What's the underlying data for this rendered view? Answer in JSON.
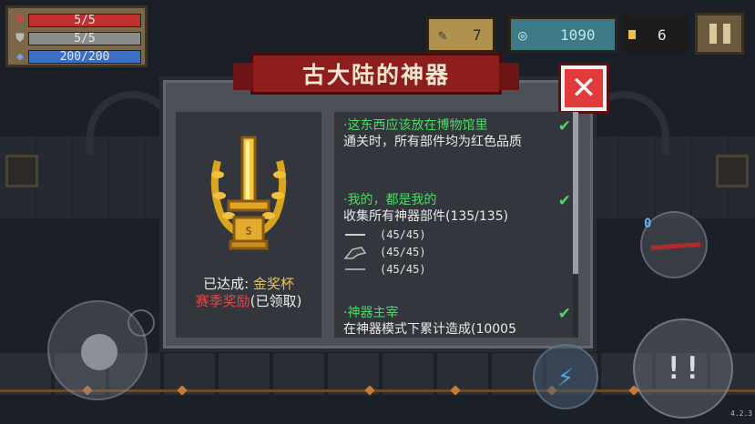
{
  "status": {
    "hp": {
      "icon": "heart-icon",
      "text": "5/5",
      "fraction": 1.0,
      "color": "#c0302e"
    },
    "armor": {
      "icon": "shield-icon",
      "text": "5/5",
      "fraction": 1.0,
      "color": "#8c8c8c"
    },
    "energy": {
      "icon": "energy-gem-icon",
      "text": "200/200",
      "fraction": 1.0,
      "color": "#3a6fc4"
    }
  },
  "hud": {
    "materials": {
      "icon": "feather-material-icon",
      "value": "7"
    },
    "gems": {
      "icon": "gem-icon",
      "value": "1090"
    },
    "coins": {
      "icon": "coin-icon",
      "value": "6"
    },
    "pause": {
      "icon": "pause-icon"
    }
  },
  "modal": {
    "title": "古大陆的神器",
    "close": {
      "icon": "close-icon"
    },
    "trophy": {
      "icon": "golden-sword-trophy-icon",
      "achieved_label": "已达成:",
      "achieved_value": "金奖杯",
      "season_reward": "赛季奖励",
      "claimed": "(已领取)"
    },
    "achievements": [
      {
        "title": "·这东西应该放在博物馆里",
        "desc": "通关时，所有部件均为红色品质",
        "completed": true
      },
      {
        "title": "·我的，都是我的",
        "desc": "收集所有神器部件(135/135)",
        "completed": true,
        "parts": [
          {
            "icon": "blade-part-icon",
            "progress": "(45/45)"
          },
          {
            "icon": "bird-part-icon",
            "progress": "(45/45)"
          },
          {
            "icon": "staff-part-icon",
            "progress": "(45/45)"
          }
        ]
      },
      {
        "title": "·神器主宰",
        "desc": "在神器模式下累计造成(10005",
        "completed": true
      }
    ],
    "scroll_position": 0.0
  },
  "controls": {
    "joystick": {
      "icon": "joystick-icon"
    },
    "skill": {
      "icon": "lightning-skill-icon"
    },
    "attack": {
      "icon": "attack-icon"
    },
    "weapon": {
      "icon": "red-sword-weapon-icon",
      "ammo": "0"
    }
  },
  "version": "4.2.3",
  "colors": {
    "accent_green": "#4fd868",
    "title_red": "#8e1e1e",
    "gold": "#e6c34a",
    "close_red": "#e23a3a"
  }
}
